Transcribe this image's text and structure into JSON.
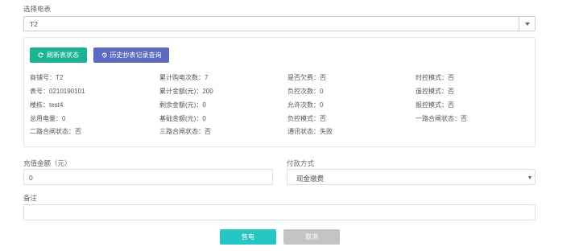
{
  "meter_select": {
    "label": "选择电表",
    "value": "T2"
  },
  "panel": {
    "refresh_button": "刷新表状态",
    "history_button": "历史抄表记录查询",
    "fields": [
      [
        "商铺号：T2",
        "累计购电次数：7",
        "是否欠费：否",
        "时控模式：否"
      ],
      [
        "表号：0210190101",
        "累计金额(元)：200",
        "负控次数：0",
        "遥控模式：否"
      ],
      [
        "楼栋：test4",
        "剩余金额(元)：0",
        "允许次数：0",
        "报控模式：否"
      ],
      [
        "总用电量：0",
        "基础金额(元)：0",
        "负控模式：否",
        "一路合闸状态：否"
      ],
      [
        "二路合闸状态：否",
        "三路合闸状态：否",
        "通讯状态：失败",
        ""
      ]
    ]
  },
  "recharge": {
    "label": "充值金额（元）",
    "value": "0"
  },
  "payment": {
    "label": "付款方式",
    "value": "现金缴费"
  },
  "remark": {
    "label": "备注",
    "value": ""
  },
  "actions": {
    "sell": "售电",
    "cancel": "取消"
  },
  "colors": {
    "primary_teal": "#1ab394",
    "history_blue": "#5c6bc0",
    "sell": "#26c6c4",
    "cancel": "#c4c4c4"
  }
}
